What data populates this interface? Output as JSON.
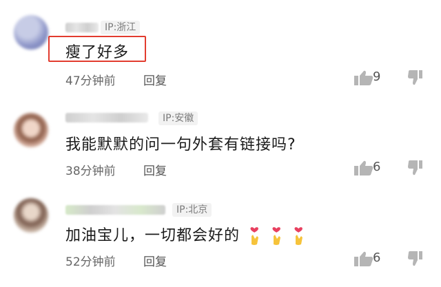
{
  "comments": [
    {
      "ip": "IP:浙江",
      "text": "瘦了好多",
      "time": "47分钟前",
      "reply": "回复",
      "likes": "9"
    },
    {
      "ip": "IP:安徽",
      "text": "我能默默的问一句外套有链接吗?",
      "time": "38分钟前",
      "reply": "回复",
      "likes": "6"
    },
    {
      "ip": "IP:北京",
      "text": "加油宝儿，一切都会好的",
      "time": "52分钟前",
      "reply": "回复",
      "likes": "6"
    }
  ],
  "icons": {
    "like": "thumbs-up-icon",
    "dislike": "thumbs-down-icon",
    "emoji": "finger-heart-emoji"
  },
  "colors": {
    "highlight_box": "#e23b2e",
    "emoji_heart": "#e8405f",
    "emoji_hand": "#f6c33b"
  }
}
